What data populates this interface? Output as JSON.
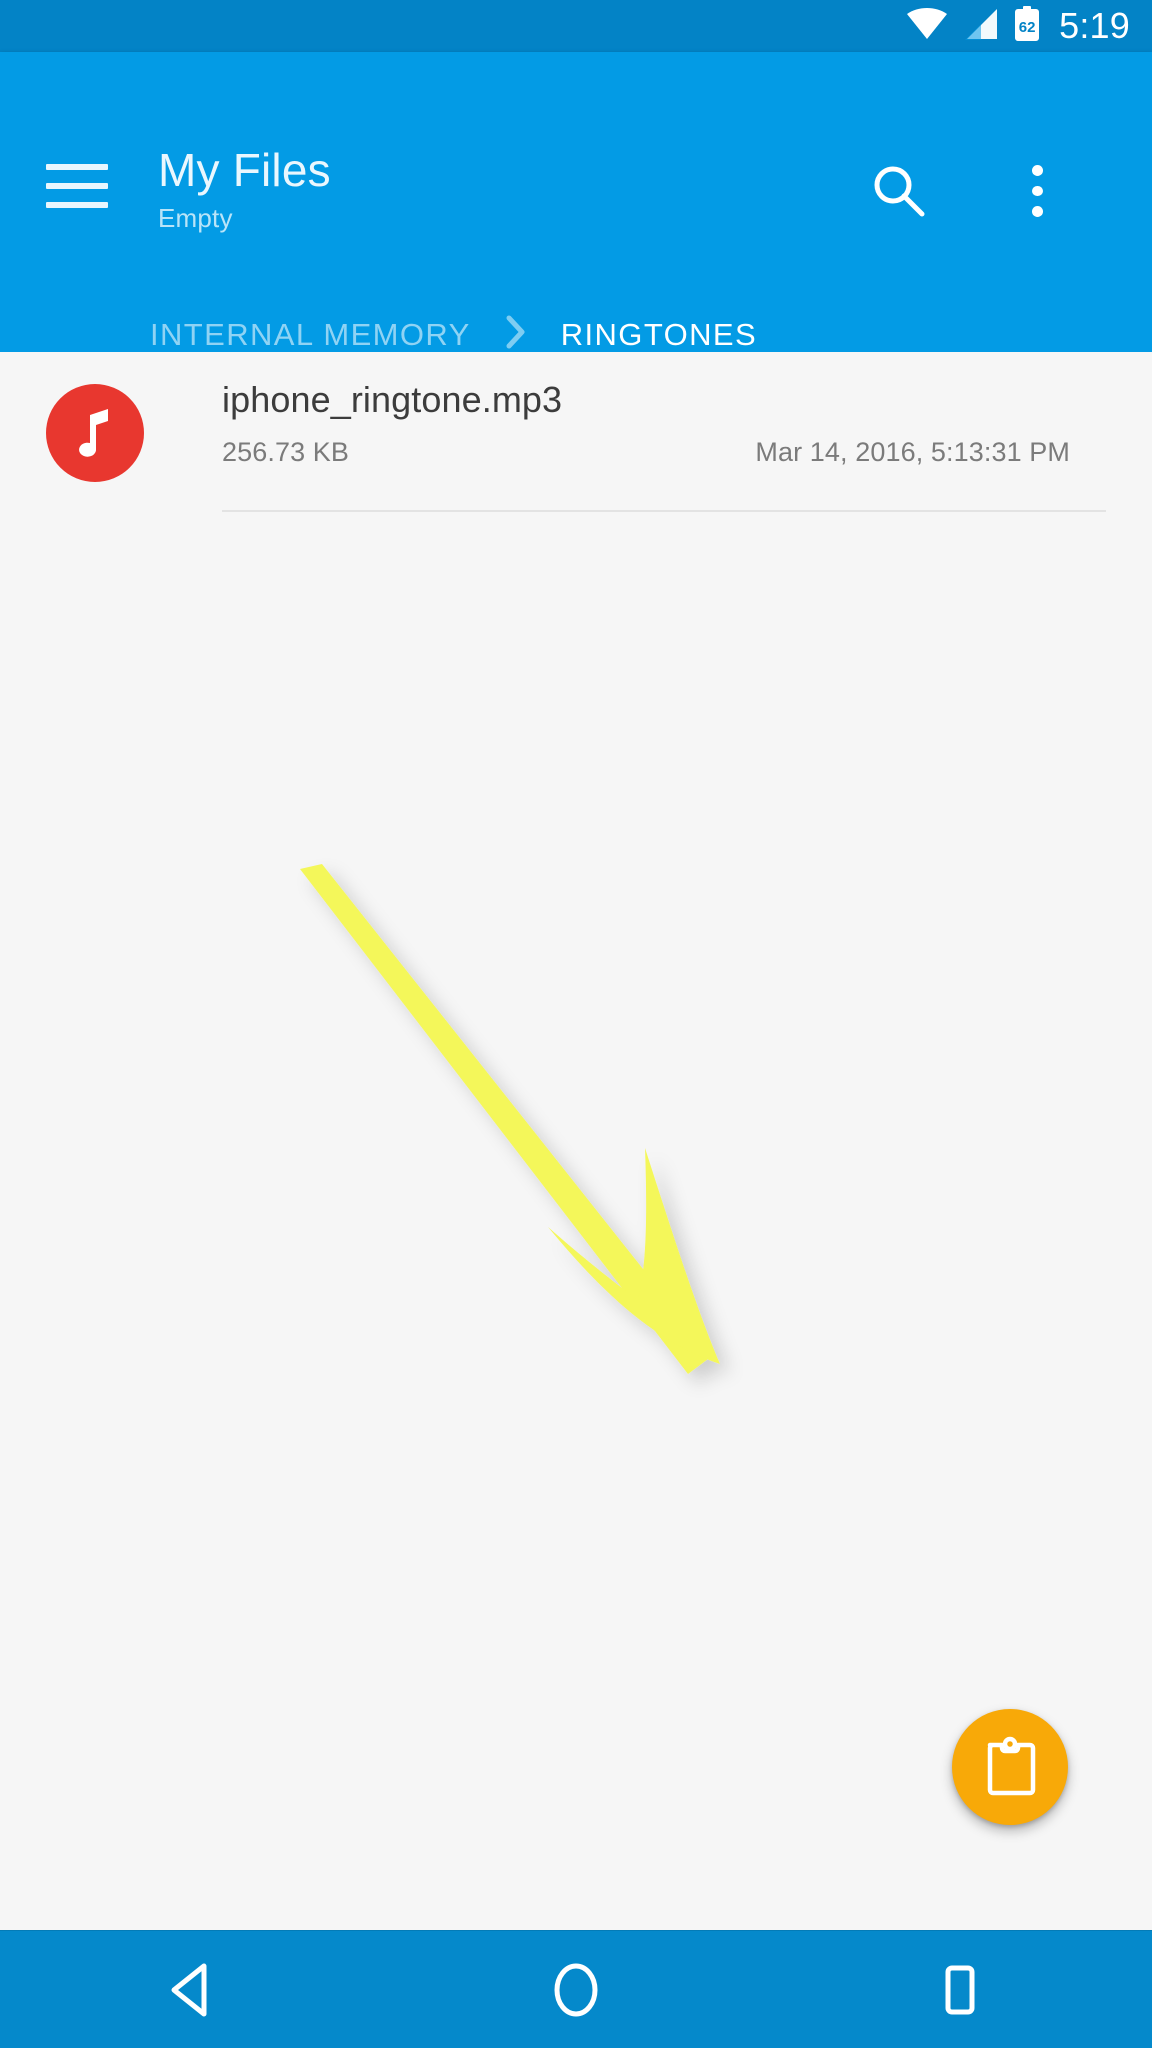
{
  "status_bar": {
    "time": "5:19",
    "battery_level": "62",
    "icons": [
      "wifi-icon",
      "cellular-signal-icon",
      "battery-icon"
    ],
    "background_color": "#0383c6"
  },
  "app_bar": {
    "menu_icon": "hamburger-menu-icon",
    "title": "My Files",
    "subtitle": "Empty",
    "search_icon": "search-icon",
    "overflow_icon": "overflow-menu-icon",
    "background_color": "#039be5"
  },
  "breadcrumb": {
    "separator_icon": "chevron-right-icon",
    "items": [
      {
        "label": "INTERNAL MEMORY",
        "active": false
      },
      {
        "label": "RINGTONES",
        "active": true
      }
    ]
  },
  "file_list": {
    "rows": [
      {
        "icon": "music-note-icon",
        "icon_color": "#e8372f",
        "name": "iphone_ringtone.mp3",
        "size": "256.73 KB",
        "date": "Mar 14, 2016, 5:13:31 PM"
      }
    ]
  },
  "fab": {
    "icon": "clipboard-paste-icon",
    "color": "#f8a908"
  },
  "annotation": {
    "type": "arrow",
    "color": "#f4f75a",
    "points_to": "fab"
  },
  "nav_bar": {
    "background_color": "#0589cb",
    "buttons": [
      {
        "icon": "back-triangle-icon",
        "name": "back"
      },
      {
        "icon": "home-circle-icon",
        "name": "home"
      },
      {
        "icon": "recents-square-icon",
        "name": "recents"
      }
    ]
  }
}
